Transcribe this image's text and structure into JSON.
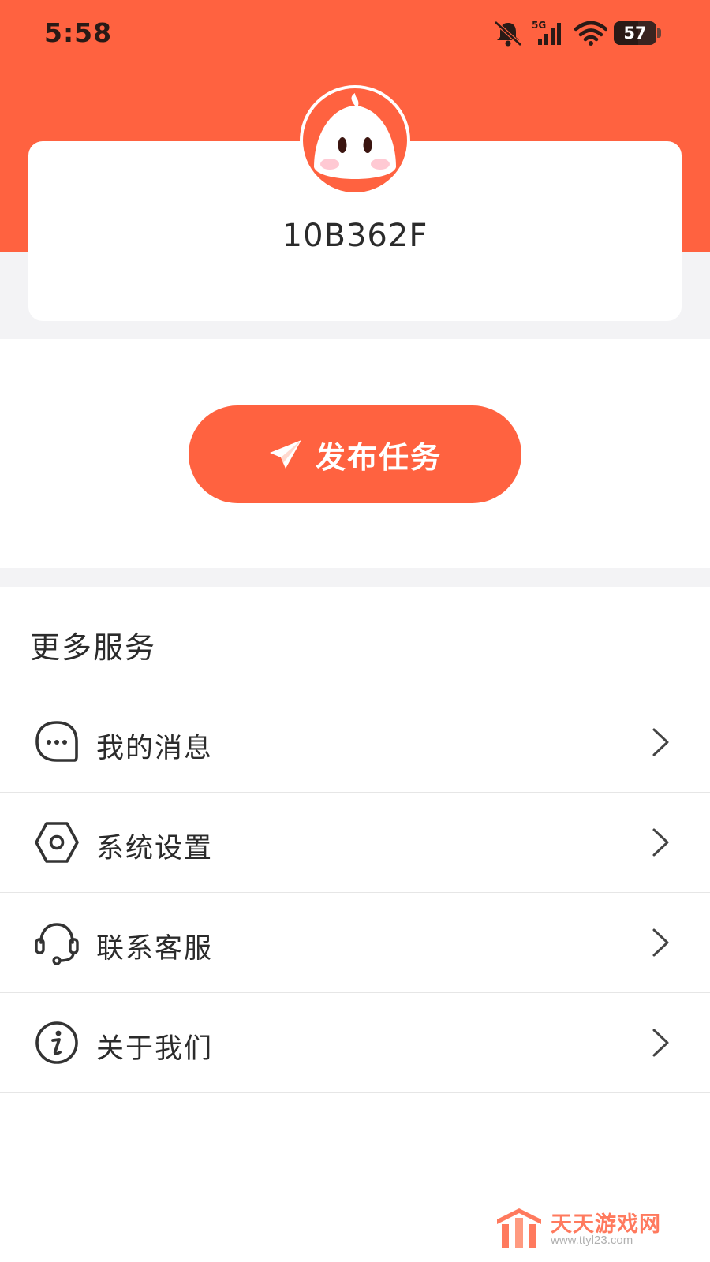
{
  "status_bar": {
    "time": "5:58",
    "network": "5G",
    "battery_level": "57",
    "icons": [
      "mute-bell-icon",
      "cellular-signal-icon",
      "wifi-icon",
      "battery-icon"
    ]
  },
  "profile": {
    "avatar": "mascot-avatar",
    "username": "10B362F"
  },
  "publish": {
    "label": "发布任务",
    "icon": "paper-plane-icon"
  },
  "services": {
    "title": "更多服务",
    "items": [
      {
        "label": "我的消息",
        "icon": "chat-bubble-icon"
      },
      {
        "label": "系统设置",
        "icon": "hexagon-settings-icon"
      },
      {
        "label": "联系客服",
        "icon": "headset-icon"
      },
      {
        "label": "关于我们",
        "icon": "info-icon"
      }
    ]
  },
  "watermark": {
    "title": "天天游戏网",
    "url": "www.ttyl23.com"
  },
  "colors": {
    "accent": "#ff6240",
    "background_gray": "#f3f3f5",
    "text": "#2b2b2b"
  }
}
